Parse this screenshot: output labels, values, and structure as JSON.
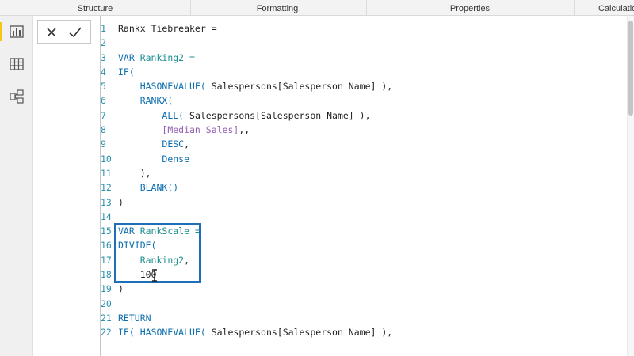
{
  "ribbon": {
    "tabs": [
      "Structure",
      "Formatting",
      "Properties",
      "Calculations"
    ]
  },
  "left_rail": {
    "icons": [
      "report-view-icon",
      "data-view-icon",
      "model-view-icon"
    ]
  },
  "formula_bar": {
    "cancel_icon": "close-icon",
    "commit_icon": "checkmark-icon"
  },
  "code": {
    "line_numbers": [
      "1",
      "2",
      "3",
      "4",
      "5",
      "6",
      "7",
      "8",
      "9",
      "10",
      "11",
      "12",
      "13",
      "14",
      "15",
      "16",
      "17",
      "18",
      "19",
      "20",
      "21",
      "22"
    ],
    "lines": [
      [
        {
          "t": "Rankx Tiebreaker ="
        }
      ],
      [],
      [
        {
          "t": "VAR ",
          "c": "blue"
        },
        {
          "t": "Ranking2 =",
          "c": "green"
        }
      ],
      [
        {
          "t": "IF(",
          "c": "blue"
        }
      ],
      [
        {
          "t": "    "
        },
        {
          "t": "HASONEVALUE(",
          "c": "blue"
        },
        {
          "t": " Salespersons[Salesperson Name] ),"
        }
      ],
      [
        {
          "t": "    "
        },
        {
          "t": "RANKX(",
          "c": "blue"
        }
      ],
      [
        {
          "t": "        "
        },
        {
          "t": "ALL(",
          "c": "blue"
        },
        {
          "t": " Salespersons[Salesperson Name] ),"
        }
      ],
      [
        {
          "t": "        "
        },
        {
          "t": "[Median Sales]",
          "c": "purple"
        },
        {
          "t": ",,"
        }
      ],
      [
        {
          "t": "        "
        },
        {
          "t": "DESC",
          "c": "blue"
        },
        {
          "t": ","
        }
      ],
      [
        {
          "t": "        "
        },
        {
          "t": "Dense",
          "c": "blue"
        }
      ],
      [
        {
          "t": "    ),"
        }
      ],
      [
        {
          "t": "    "
        },
        {
          "t": "BLANK()",
          "c": "blue"
        }
      ],
      [
        {
          "t": ")"
        }
      ],
      [],
      [
        {
          "t": "VAR ",
          "c": "blue"
        },
        {
          "t": "RankScale =",
          "c": "green"
        }
      ],
      [
        {
          "t": "DIVIDE(",
          "c": "blue"
        }
      ],
      [
        {
          "t": "    "
        },
        {
          "t": "Ranking2",
          "c": "green"
        },
        {
          "t": ","
        }
      ],
      [
        {
          "t": "    100"
        }
      ],
      [
        {
          "t": ")"
        }
      ],
      [],
      [
        {
          "t": "RETURN",
          "c": "blue"
        }
      ],
      [
        {
          "t": "IF(",
          "c": "blue"
        },
        {
          "t": " "
        },
        {
          "t": "HASONEVALUE(",
          "c": "blue"
        },
        {
          "t": " Salespersons[Salesperson Name] ),"
        }
      ]
    ]
  },
  "colors": {
    "keyword": "#0d6fb0",
    "variable": "#1d8f8f",
    "measure": "#9361b4",
    "highlight_box": "#1f6fb8",
    "active_view_marker": "#f2c811"
  }
}
